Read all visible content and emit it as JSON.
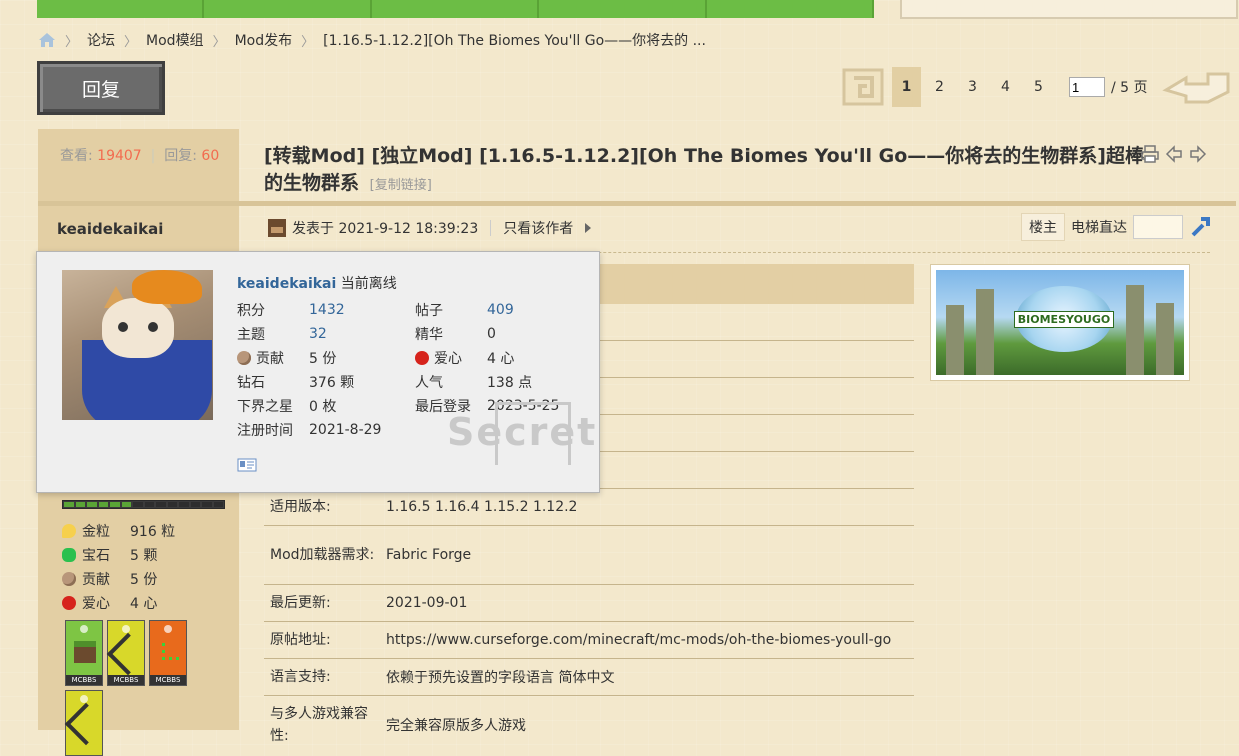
{
  "breadcrumb": [
    "论坛",
    "Mod模组",
    "Mod发布",
    "[1.16.5-1.12.2][Oh The Biomes You'll Go——你将去的 ..."
  ],
  "reply_button": "回复",
  "pagination": {
    "pages": [
      "1",
      "2",
      "3",
      "4",
      "5"
    ],
    "current": "1",
    "input_value": "1",
    "total": "/ 5 页"
  },
  "stats": {
    "views_label": "查看:",
    "views": "19407",
    "replies_label": "回复:",
    "replies": "60"
  },
  "post": {
    "title": "[转载Mod] [独立Mod] [1.16.5-1.12.2][Oh The Biomes You'll Go——你将去的生物群系]超棒的生物群系",
    "copy_link": "[复制链接]",
    "author": "keaidekaikai",
    "posted": "发表于 2021-9-12 18:39:23",
    "only_author": "只看该作者",
    "floor_label": "楼主",
    "elevator": "电梯直达"
  },
  "popup": {
    "username": "keaidekaikai",
    "status": "当前离线",
    "fields": [
      [
        "积分",
        "1432",
        "帖子",
        "409"
      ],
      [
        "主题",
        "32",
        "精华",
        "0"
      ],
      [
        "贡献",
        "5 份",
        "爱心",
        "4 心"
      ],
      [
        "钻石",
        "376 颗",
        "人气",
        "138 点"
      ],
      [
        "下界之星",
        "0 枚",
        "最后登录",
        "2023-5-25"
      ],
      [
        "注册时间",
        "2021-8-29",
        "",
        ""
      ]
    ],
    "watermark": "Secret"
  },
  "info_rows": [
    [
      "适用版本:",
      "1.16.5 1.16.4 1.15.2 1.12.2"
    ],
    [
      "Mod加载器需求:",
      "Fabric Forge"
    ],
    [
      "最后更新:",
      "2021-09-01"
    ],
    [
      "原帖地址:",
      "https://www.curseforge.com/minecraft/mc-mods/oh-the-biomes-youll-go"
    ],
    [
      "语言支持:",
      "依赖于预先设置的字段语言 简体中文"
    ],
    [
      "与多人游戏兼容性:",
      "完全兼容原版多人游戏"
    ]
  ],
  "user_stats": [
    [
      "金粒",
      "916 粒"
    ],
    [
      "宝石",
      "5 颗"
    ],
    [
      "贡献",
      "5 份"
    ],
    [
      "爱心",
      "4 心"
    ]
  ],
  "badge_label": "MCBBS",
  "cover_logo": "BIOMESYOUGO",
  "colors": {
    "nav_green": "#6cbd45",
    "panel": "#e3cfa4",
    "accent_red": "#f26c4f",
    "link_blue": "#336699"
  }
}
